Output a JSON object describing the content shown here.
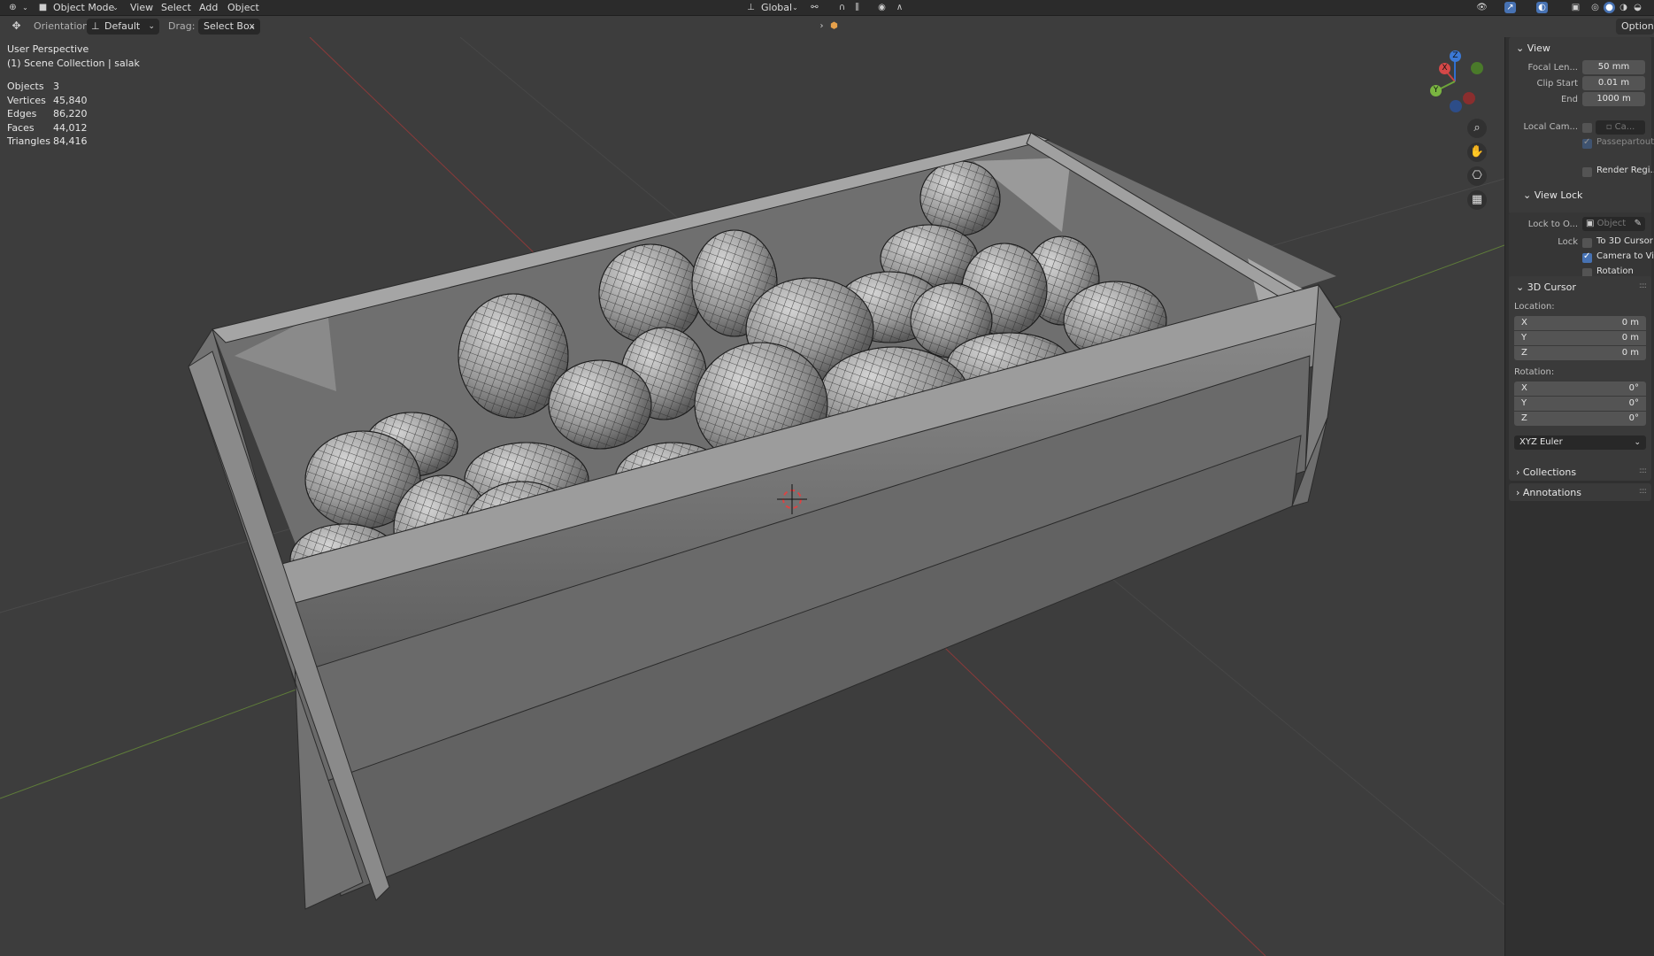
{
  "header": {
    "mode": "Object Mode",
    "menus": [
      "View",
      "Select",
      "Add",
      "Object"
    ],
    "transform_orientation": "Global",
    "options_label": "Options"
  },
  "toolbar": {
    "orientation_label": "Orientation:",
    "orientation_value": "Default",
    "drag_label": "Drag:",
    "drag_value": "Select Box"
  },
  "viewport": {
    "perspective": "User Perspective",
    "collection": "(1) Scene Collection | salak",
    "stats": [
      {
        "label": "Objects",
        "value": "3"
      },
      {
        "label": "Vertices",
        "value": "45,840"
      },
      {
        "label": "Edges",
        "value": "86,220"
      },
      {
        "label": "Faces",
        "value": "44,012"
      },
      {
        "label": "Triangles",
        "value": "84,416"
      }
    ],
    "gizmo": {
      "x": "X",
      "y": "Y",
      "z": "Z"
    }
  },
  "sidebar": {
    "view": {
      "title": "View",
      "focal_label": "Focal Len...",
      "focal_value": "50 mm",
      "clip_start_label": "Clip Start",
      "clip_start_value": "0.01 m",
      "end_label": "End",
      "end_value": "1000 m",
      "local_cam_label": "Local Cam...",
      "local_cam_value": "Ca...",
      "passepartout_label": "Passepartout",
      "render_region_label": "Render Regi..."
    },
    "view_lock": {
      "title": "View Lock",
      "lock_to_label": "Lock to O...",
      "lock_to_placeholder": "Object",
      "lock_label": "Lock",
      "to_cursor_label": "To 3D Cursor",
      "camera_to_view_label": "Camera to Vi...",
      "camera_to_view_checked": true,
      "rotation_label": "Rotation"
    },
    "cursor": {
      "title": "3D Cursor",
      "location_label": "Location:",
      "location": [
        {
          "axis": "X",
          "value": "0 m"
        },
        {
          "axis": "Y",
          "value": "0 m"
        },
        {
          "axis": "Z",
          "value": "0 m"
        }
      ],
      "rotation_label": "Rotation:",
      "rotation": [
        {
          "axis": "X",
          "value": "0°"
        },
        {
          "axis": "Y",
          "value": "0°"
        },
        {
          "axis": "Z",
          "value": "0°"
        }
      ],
      "rotation_mode": "XYZ Euler"
    },
    "collections_title": "Collections",
    "annotations_title": "Annotations"
  }
}
